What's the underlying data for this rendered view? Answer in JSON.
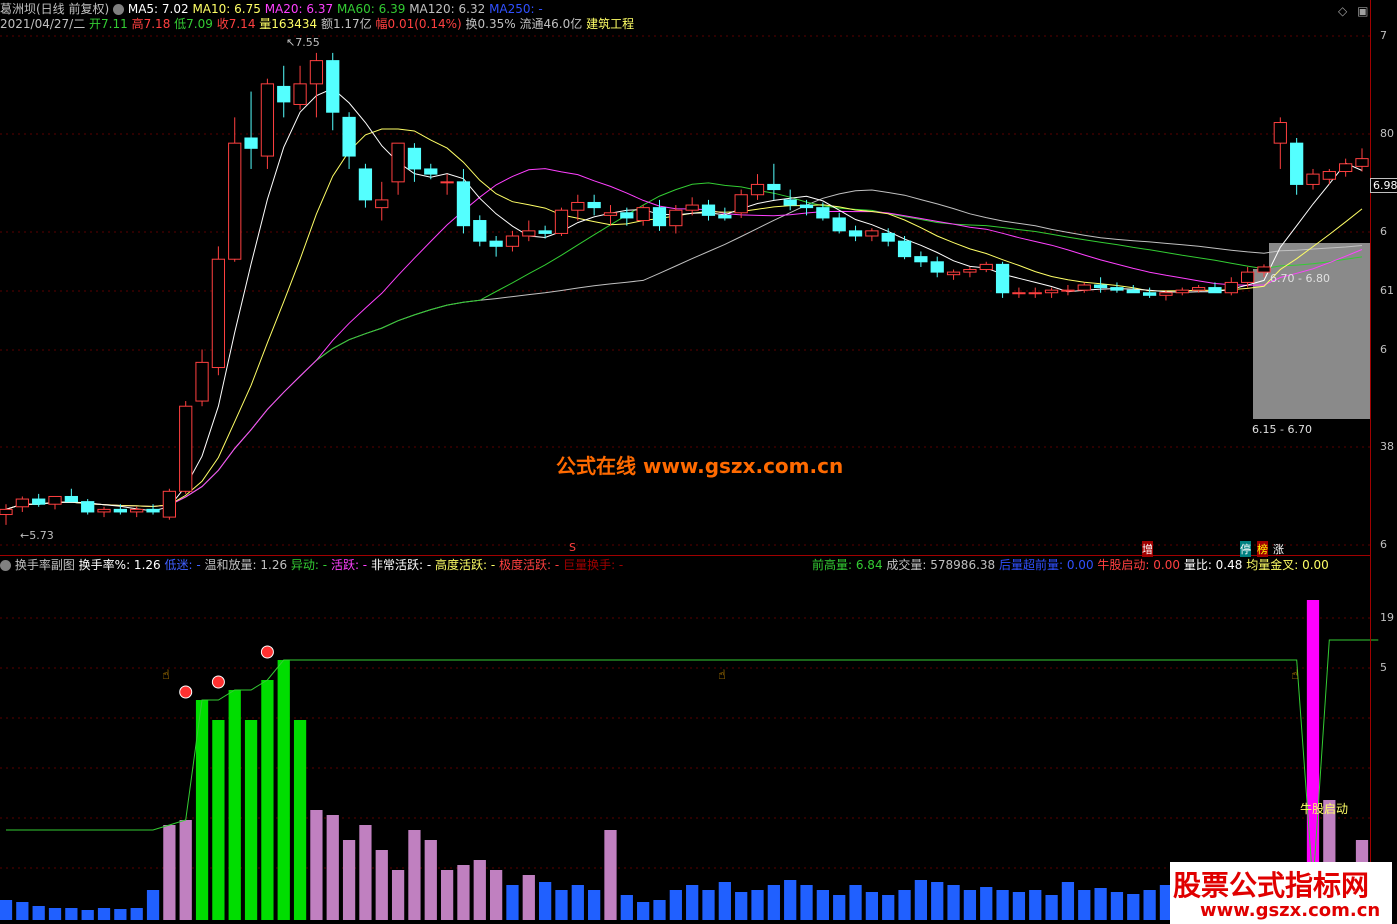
{
  "header_main": {
    "stock_name": "葛洲坝(日线 前复权)",
    "ma5": "MA5: 7.02",
    "ma10": "MA10: 6.75",
    "ma20": "MA20: 6.37",
    "ma60": "MA60: 6.39",
    "ma120": "MA120: 6.32",
    "ma250": "MA250: -"
  },
  "header_quote": {
    "date": "2021/04/27/二",
    "open": "开7.11",
    "high": "高7.18",
    "low": "低7.09",
    "close": "收7.14",
    "volume": "量163434",
    "amount": "额1.17亿",
    "change": "幅0.01(0.14%)",
    "turnover": "换0.35%",
    "float_cap": "流通46.0亿",
    "sector": "建筑工程"
  },
  "sub_header": {
    "title": "换手率副图",
    "turnover_label": "换手率%: 1.26",
    "low_label": "低迷: -",
    "mild_label": "温和放量: 1.26",
    "move_label": "异动: -",
    "active_label": "活跃: -",
    "very_active_label": "非常活跃: -",
    "high_active_label": "高度活跃: -",
    "extreme_label": "极度活跃: -",
    "huge_label": "巨量换手: -"
  },
  "sub_header_right": {
    "prev_high": "前高量: 6.84",
    "volume_label": "成交量: 578986.38",
    "super_vol": "后量超前量: 0.00",
    "bull_start": "牛股启动: 0.00",
    "vol_ratio": "量比: 0.48",
    "avg_cross": "均量金叉: 0.00"
  },
  "annotations": {
    "high_mark": "7.55",
    "low_mark": "5.73",
    "price_tag": "6.98",
    "zone1_label": "6.70 - 6.80",
    "zone2_label": "6.15 - 6.70",
    "signal_s": "S",
    "signal_zeng": "增",
    "signal_ting": "停",
    "signal_bang": "榜",
    "signal_zhang": "涨",
    "bull_label": "牛股启动"
  },
  "watermark": "公式在线  www.gszx.com.cn",
  "logo": {
    "line1": "股票公式指标网",
    "line2": "www.gszx.com.cn"
  },
  "axis_labels": [
    "7",
    "80",
    "6",
    "61",
    "6",
    "38",
    "6",
    "19",
    "5"
  ],
  "colors": {
    "up": "#ff4040",
    "down": "#54ffff",
    "ma5": "#ffffff",
    "ma10": "#ffff66",
    "ma20": "#ff40ff",
    "ma60": "#33cc33",
    "ma120": "#c0c0c0",
    "turnover_high": "#00dd00",
    "turnover_mid": "#c080c0",
    "turnover_low": "#2060ff",
    "turnover_peak": "#ff00ff"
  },
  "chart_data": {
    "type": "candlestick",
    "candles": [
      [
        5.76,
        5.8,
        5.72,
        5.78
      ],
      [
        5.79,
        5.83,
        5.77,
        5.82
      ],
      [
        5.82,
        5.84,
        5.79,
        5.8
      ],
      [
        5.8,
        5.83,
        5.78,
        5.83
      ],
      [
        5.83,
        5.86,
        5.81,
        5.81
      ],
      [
        5.81,
        5.82,
        5.76,
        5.77
      ],
      [
        5.77,
        5.79,
        5.75,
        5.78
      ],
      [
        5.78,
        5.8,
        5.76,
        5.77
      ],
      [
        5.77,
        5.79,
        5.75,
        5.78
      ],
      [
        5.78,
        5.8,
        5.76,
        5.77
      ],
      [
        5.75,
        5.86,
        5.74,
        5.85
      ],
      [
        5.85,
        6.2,
        5.84,
        6.18
      ],
      [
        6.2,
        6.4,
        6.18,
        6.35
      ],
      [
        6.33,
        6.8,
        6.3,
        6.75
      ],
      [
        6.75,
        7.3,
        6.74,
        7.2
      ],
      [
        7.22,
        7.4,
        7.1,
        7.18
      ],
      [
        7.15,
        7.45,
        7.1,
        7.43
      ],
      [
        7.42,
        7.5,
        7.3,
        7.36
      ],
      [
        7.35,
        7.5,
        7.33,
        7.43
      ],
      [
        7.43,
        7.55,
        7.3,
        7.52
      ],
      [
        7.52,
        7.55,
        7.25,
        7.32
      ],
      [
        7.3,
        7.32,
        7.1,
        7.15
      ],
      [
        7.1,
        7.12,
        6.95,
        6.98
      ],
      [
        6.95,
        7.05,
        6.9,
        6.98
      ],
      [
        7.05,
        7.2,
        7.0,
        7.2
      ],
      [
        7.18,
        7.2,
        7.05,
        7.1
      ],
      [
        7.1,
        7.12,
        7.06,
        7.08
      ],
      [
        7.05,
        7.08,
        7.0,
        7.05
      ],
      [
        7.05,
        7.1,
        6.85,
        6.88
      ],
      [
        6.9,
        6.92,
        6.8,
        6.82
      ],
      [
        6.82,
        6.84,
        6.76,
        6.8
      ],
      [
        6.8,
        6.86,
        6.78,
        6.84
      ],
      [
        6.84,
        6.9,
        6.82,
        6.86
      ],
      [
        6.86,
        6.88,
        6.83,
        6.85
      ],
      [
        6.85,
        6.95,
        6.84,
        6.94
      ],
      [
        6.94,
        7.0,
        6.9,
        6.97
      ],
      [
        6.97,
        7.0,
        6.92,
        6.95
      ],
      [
        6.92,
        6.96,
        6.88,
        6.93
      ],
      [
        6.93,
        6.95,
        6.88,
        6.91
      ],
      [
        6.9,
        6.96,
        6.88,
        6.95
      ],
      [
        6.95,
        6.98,
        6.86,
        6.88
      ],
      [
        6.88,
        6.96,
        6.85,
        6.94
      ],
      [
        6.94,
        6.99,
        6.92,
        6.96
      ],
      [
        6.96,
        6.98,
        6.9,
        6.92
      ],
      [
        6.92,
        6.95,
        6.9,
        6.91
      ],
      [
        6.93,
        7.02,
        6.91,
        7.0
      ],
      [
        7.0,
        7.08,
        6.98,
        7.04
      ],
      [
        7.04,
        7.12,
        6.98,
        7.02
      ],
      [
        6.98,
        7.02,
        6.94,
        6.96
      ],
      [
        6.96,
        6.98,
        6.92,
        6.95
      ],
      [
        6.95,
        6.97,
        6.9,
        6.91
      ],
      [
        6.91,
        6.93,
        6.85,
        6.86
      ],
      [
        6.86,
        6.88,
        6.82,
        6.84
      ],
      [
        6.84,
        6.87,
        6.82,
        6.86
      ],
      [
        6.85,
        6.87,
        6.8,
        6.82
      ],
      [
        6.82,
        6.84,
        6.75,
        6.76
      ],
      [
        6.76,
        6.78,
        6.72,
        6.74
      ],
      [
        6.74,
        6.76,
        6.68,
        6.7
      ],
      [
        6.69,
        6.71,
        6.67,
        6.7
      ],
      [
        6.7,
        6.72,
        6.68,
        6.71
      ],
      [
        6.71,
        6.74,
        6.7,
        6.73
      ],
      [
        6.73,
        6.74,
        6.6,
        6.62
      ],
      [
        6.62,
        6.64,
        6.6,
        6.62
      ],
      [
        6.62,
        6.64,
        6.6,
        6.62
      ],
      [
        6.62,
        6.64,
        6.6,
        6.63
      ],
      [
        6.63,
        6.65,
        6.61,
        6.63
      ],
      [
        6.63,
        6.66,
        6.62,
        6.65
      ],
      [
        6.65,
        6.68,
        6.62,
        6.64
      ],
      [
        6.64,
        6.66,
        6.62,
        6.63
      ],
      [
        6.63,
        6.65,
        6.62,
        6.62
      ],
      [
        6.62,
        6.64,
        6.6,
        6.61
      ],
      [
        6.61,
        6.63,
        6.59,
        6.62
      ],
      [
        6.62,
        6.64,
        6.61,
        6.63
      ],
      [
        6.63,
        6.65,
        6.62,
        6.64
      ],
      [
        6.64,
        6.66,
        6.62,
        6.62
      ],
      [
        6.62,
        6.68,
        6.61,
        6.66
      ],
      [
        6.66,
        6.72,
        6.64,
        6.7
      ],
      [
        6.7,
        6.73,
        6.68,
        6.72
      ],
      [
        7.2,
        7.3,
        7.1,
        7.28
      ],
      [
        7.2,
        7.22,
        7.0,
        7.04
      ],
      [
        7.04,
        7.1,
        7.02,
        7.08
      ],
      [
        7.06,
        7.1,
        7.04,
        7.09
      ],
      [
        7.09,
        7.14,
        7.07,
        7.12
      ],
      [
        7.11,
        7.18,
        7.09,
        7.14
      ]
    ],
    "ylim": [
      5.7,
      7.6
    ],
    "turnover": [
      0.2,
      0.18,
      0.14,
      0.12,
      0.12,
      0.1,
      0.12,
      0.11,
      0.12,
      0.3,
      0.95,
      1.0,
      2.2,
      2.0,
      2.3,
      2.0,
      2.4,
      2.6,
      2.0,
      1.1,
      1.05,
      0.8,
      0.95,
      0.7,
      0.5,
      0.9,
      0.8,
      0.5,
      0.55,
      0.6,
      0.5,
      0.35,
      0.45,
      0.38,
      0.3,
      0.35,
      0.3,
      0.9,
      0.25,
      0.18,
      0.2,
      0.3,
      0.35,
      0.3,
      0.38,
      0.28,
      0.3,
      0.35,
      0.4,
      0.35,
      0.3,
      0.25,
      0.35,
      0.28,
      0.25,
      0.3,
      0.4,
      0.38,
      0.35,
      0.3,
      0.33,
      0.3,
      0.28,
      0.3,
      0.25,
      0.38,
      0.3,
      0.32,
      0.28,
      0.26,
      0.3,
      0.35,
      0.28,
      0.32,
      0.25,
      0.22,
      0.2,
      0.1,
      0.08,
      0.12,
      3.2,
      1.2,
      0.5,
      0.8,
      0.45
    ],
    "turnover_ylim": [
      0,
      3.4
    ]
  }
}
